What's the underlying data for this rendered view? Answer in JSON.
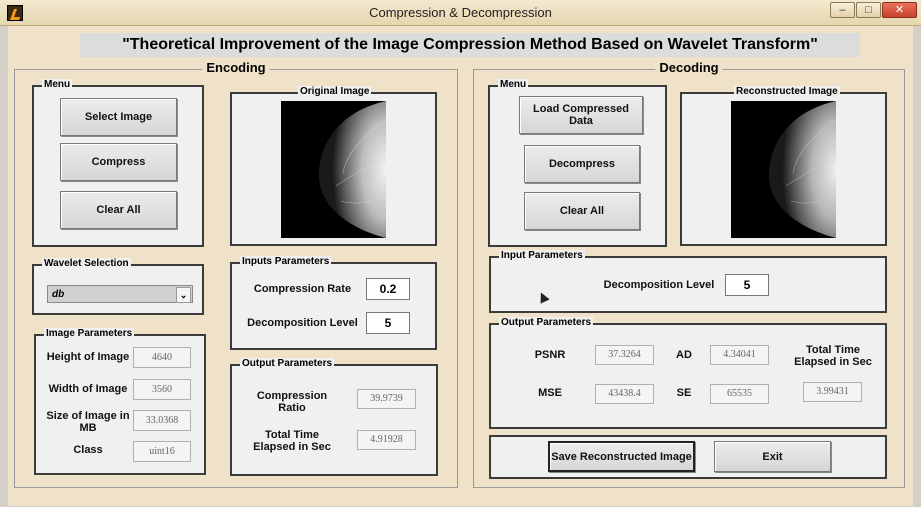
{
  "window": {
    "title": "Compression & Decompression",
    "min": "–",
    "max": "□",
    "close": "✕"
  },
  "main_title": "\"Theoretical Improvement of the Image Compression Method Based on Wavelet Transform\"",
  "encoding": {
    "title": "Encoding",
    "menu": {
      "title": "Menu",
      "select_image": "Select Image",
      "compress": "Compress",
      "clear_all": "Clear All"
    },
    "original_image": {
      "title": "Original Image"
    },
    "wavelet": {
      "title": "Wavelet Selection",
      "selected": "db"
    },
    "image_params": {
      "title": "Image Parameters",
      "height_label": "Height of Image",
      "height_value": "4640",
      "width_label": "Width of Image",
      "width_value": "3560",
      "size_label": "Size of Image in MB",
      "size_value": "33.0368",
      "class_label": "Class",
      "class_value": "uint16"
    },
    "inputs": {
      "title": "Inputs Parameters",
      "rate_label": "Compression Rate",
      "rate_value": "0.2",
      "level_label": "Decomposition Level",
      "level_value": "5"
    },
    "outputs": {
      "title": "Output Parameters",
      "ratio_label": "Compression Ratio",
      "ratio_value": "39.9739",
      "time_label": "Total Time Elapsed in Sec",
      "time_value": "4.91928"
    }
  },
  "decoding": {
    "title": "Decoding",
    "menu": {
      "title": "Menu",
      "load": "Load Compressed Data",
      "decompress": "Decompress",
      "clear_all": "Clear All"
    },
    "reconstructed_image": {
      "title": "Reconstructed Image"
    },
    "inputs": {
      "title": "Input Parameters",
      "level_label": "Decomposition Level",
      "level_value": "5"
    },
    "outputs": {
      "title": "Output Parameters",
      "psnr_label": "PSNR",
      "psnr_value": "37.3264",
      "ad_label": "AD",
      "ad_value": "4.34041",
      "time_label": "Total Time Elapsed in Sec",
      "time_value": "3.99431",
      "mse_label": "MSE",
      "mse_value": "43438.4",
      "se_label": "SE",
      "se_value": "65535"
    },
    "save": "Save Reconstructed Image",
    "exit": "Exit"
  }
}
